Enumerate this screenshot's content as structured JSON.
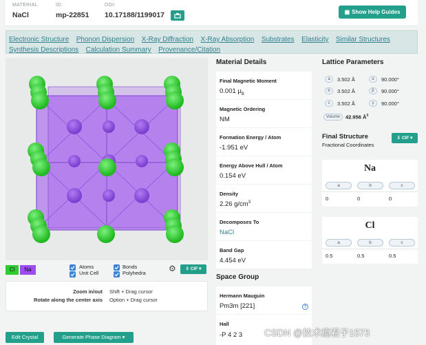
{
  "header": {
    "material_label": "MATERIAL",
    "material_value": "NaCl",
    "id_label": "ID:",
    "id_value": "mp-22851",
    "doi_label": "DOI:",
    "doi_value": "10.17188/1199017",
    "help_button": "Show Help Guides"
  },
  "nav": {
    "row1": [
      "Electronic Structure",
      "Phonon Dispersion",
      "X-Ray Diffraction",
      "X-Ray Absorption",
      "Substrates",
      "Elasticity",
      "Similar Structures"
    ],
    "row2": [
      "Synthesis Descriptions",
      "Calculation Summary",
      "Provenance/Citation"
    ]
  },
  "viewer": {
    "legend_cl": "Cl",
    "legend_na": "Na",
    "atoms": "Atoms",
    "unit_cell": "Unit Cell",
    "bonds": "Bonds",
    "polyhedra": "Polyhedra",
    "cif_button": "CIF",
    "zoom_key": "Zoom in/out",
    "zoom_val": "Shift + Drag cursor",
    "rotate_key": "Rotate along the center axis",
    "rotate_val": "Option + Drag cursor",
    "colors": {
      "cl": "#2ecc2e",
      "na": "#9b4dee"
    }
  },
  "buttons": {
    "edit_crystal": "Edit Crystal",
    "phase_diagram": "Generate Phase Diagram ▾"
  },
  "material_details": {
    "title": "Material Details",
    "items": [
      {
        "label": "Final Magnetic Moment",
        "value": "0.001 μB"
      },
      {
        "label": "Magnetic Ordering",
        "value": "NM"
      },
      {
        "label": "Formation Energy / Atom",
        "value": "-1.951 eV"
      },
      {
        "label": "Energy Above Hull / Atom",
        "value": "0.154 eV"
      },
      {
        "label": "Density",
        "value": "2.26 g/cm3"
      },
      {
        "label": "Decomposes To",
        "value": "NaCl"
      },
      {
        "label": "Band Gap",
        "value": "4.454 eV"
      }
    ]
  },
  "space_group": {
    "title": "Space Group",
    "hm_label": "Hermann Mauguin",
    "hm_value": "Pm3m [221]",
    "hall_label": "Hall",
    "hall_value": "-P 4 2 3"
  },
  "lattice": {
    "title": "Lattice Parameters",
    "rows": [
      {
        "axis": "a",
        "length": "3.502 Å",
        "angle_sym": "α",
        "angle": "90.000°"
      },
      {
        "axis": "b",
        "length": "3.502 Å",
        "angle_sym": "β",
        "angle": "90.000°"
      },
      {
        "axis": "c",
        "length": "3.502 Å",
        "angle_sym": "γ",
        "angle": "90.000°"
      }
    ],
    "volume_label": "Volume",
    "volume_value": "42.956 Å3"
  },
  "final_structure": {
    "title": "Final Structure",
    "subtitle": "Fractional Coordinates",
    "cif_button": "CIF",
    "sites": [
      {
        "element": "Na",
        "headers": [
          "a",
          "b",
          "c"
        ],
        "coords": [
          "0",
          "0",
          "0"
        ]
      },
      {
        "element": "Cl",
        "headers": [
          "a",
          "b",
          "c"
        ],
        "coords": [
          "0.5",
          "0.5",
          "0.5"
        ]
      }
    ]
  },
  "watermark": "CSDN @技术瘾君子1573"
}
